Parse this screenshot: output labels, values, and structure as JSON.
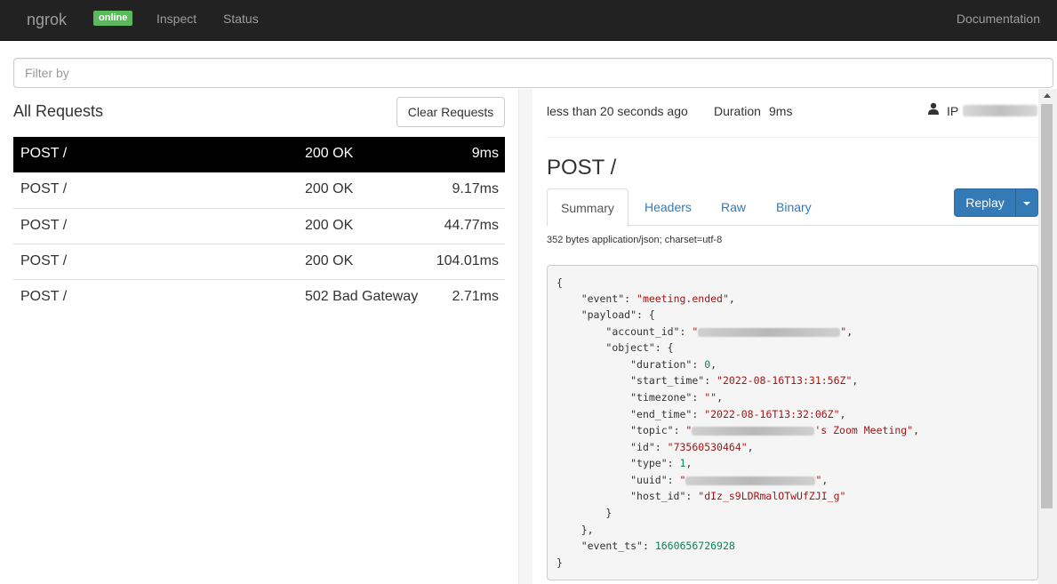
{
  "nav": {
    "brand": "ngrok",
    "status_badge": "online",
    "inspect": "Inspect",
    "status": "Status",
    "documentation": "Documentation"
  },
  "filter": {
    "placeholder": "Filter by"
  },
  "requests": {
    "title": "All Requests",
    "clear_label": "Clear Requests",
    "items": [
      {
        "method": "POST /",
        "status": "200 OK",
        "duration": "9ms",
        "selected": true
      },
      {
        "method": "POST /",
        "status": "200 OK",
        "duration": "9.17ms"
      },
      {
        "method": "POST /",
        "status": "200 OK",
        "duration": "44.77ms"
      },
      {
        "method": "POST /",
        "status": "200 OK",
        "duration": "104.01ms"
      },
      {
        "method": "POST /",
        "status": "502 Bad Gateway",
        "duration": "2.71ms"
      }
    ]
  },
  "detail": {
    "when": "less than 20 seconds ago",
    "duration_label": "Duration",
    "duration_value": "9ms",
    "ip_label": "IP",
    "title": "POST /",
    "tabs": [
      "Summary",
      "Headers",
      "Raw",
      "Binary"
    ],
    "replay_label": "Replay",
    "content_type": "352 bytes application/json; charset=utf-8",
    "json": {
      "event_key": "\"event\"",
      "event_val": "\"meeting.ended\"",
      "payload_key": "\"payload\"",
      "account_id_key": "\"account_id\"",
      "object_key": "\"object\"",
      "duration_key": "\"duration\"",
      "duration_val": "0",
      "start_time_key": "\"start_time\"",
      "start_time_val": "\"2022-08-16T13:31:56Z\"",
      "timezone_key": "\"timezone\"",
      "timezone_val": "\"\"",
      "end_time_key": "\"end_time\"",
      "end_time_val": "\"2022-08-16T13:32:06Z\"",
      "topic_key": "\"topic\"",
      "topic_val_tail": "'s Zoom Meeting\"",
      "id_key": "\"id\"",
      "id_val": "\"73560530464\"",
      "type_key": "\"type\"",
      "type_val": "1",
      "uuid_key": "\"uuid\"",
      "host_id_key": "\"host_id\"",
      "host_id_val": "\"dIz_s9LDRmalOTwUfZJI_g\"",
      "event_ts_key": "\"event_ts\"",
      "event_ts_val": "1660656726928"
    }
  },
  "colors": {
    "nav_bg": "#222222",
    "badge": "#5cb85c",
    "selected_row": "#000000",
    "primary": "#337ab7",
    "json_string": "#a31515",
    "json_number": "#098658"
  }
}
